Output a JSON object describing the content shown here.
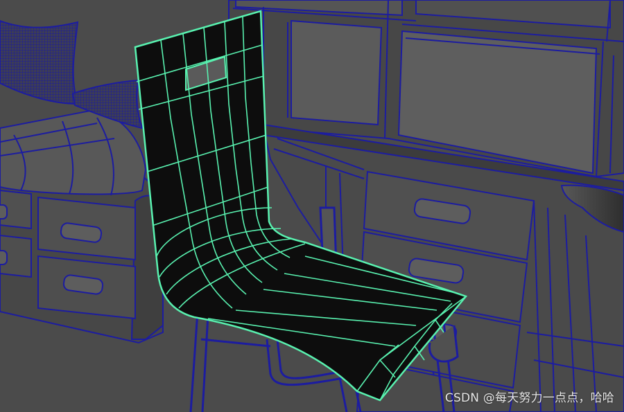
{
  "viewport": {
    "watermark": "CSDN @每天努力一点点，哈哈"
  },
  "colors": {
    "background": "#4b4b4b",
    "wireframe": "#1c1ca0",
    "selected_wire": "#59f2b0",
    "selected_fill": "#0d0d0d",
    "surface_dark": "#444444",
    "surface_light": "#5a5a5a"
  },
  "objects": [
    {
      "name": "chair",
      "state": "selected"
    },
    {
      "name": "cabinet",
      "state": "wireframe-on-shaded"
    },
    {
      "name": "desk",
      "state": "wireframe-on-shaded"
    },
    {
      "name": "bench-with-pillows",
      "state": "wireframe-on-shaded"
    }
  ]
}
